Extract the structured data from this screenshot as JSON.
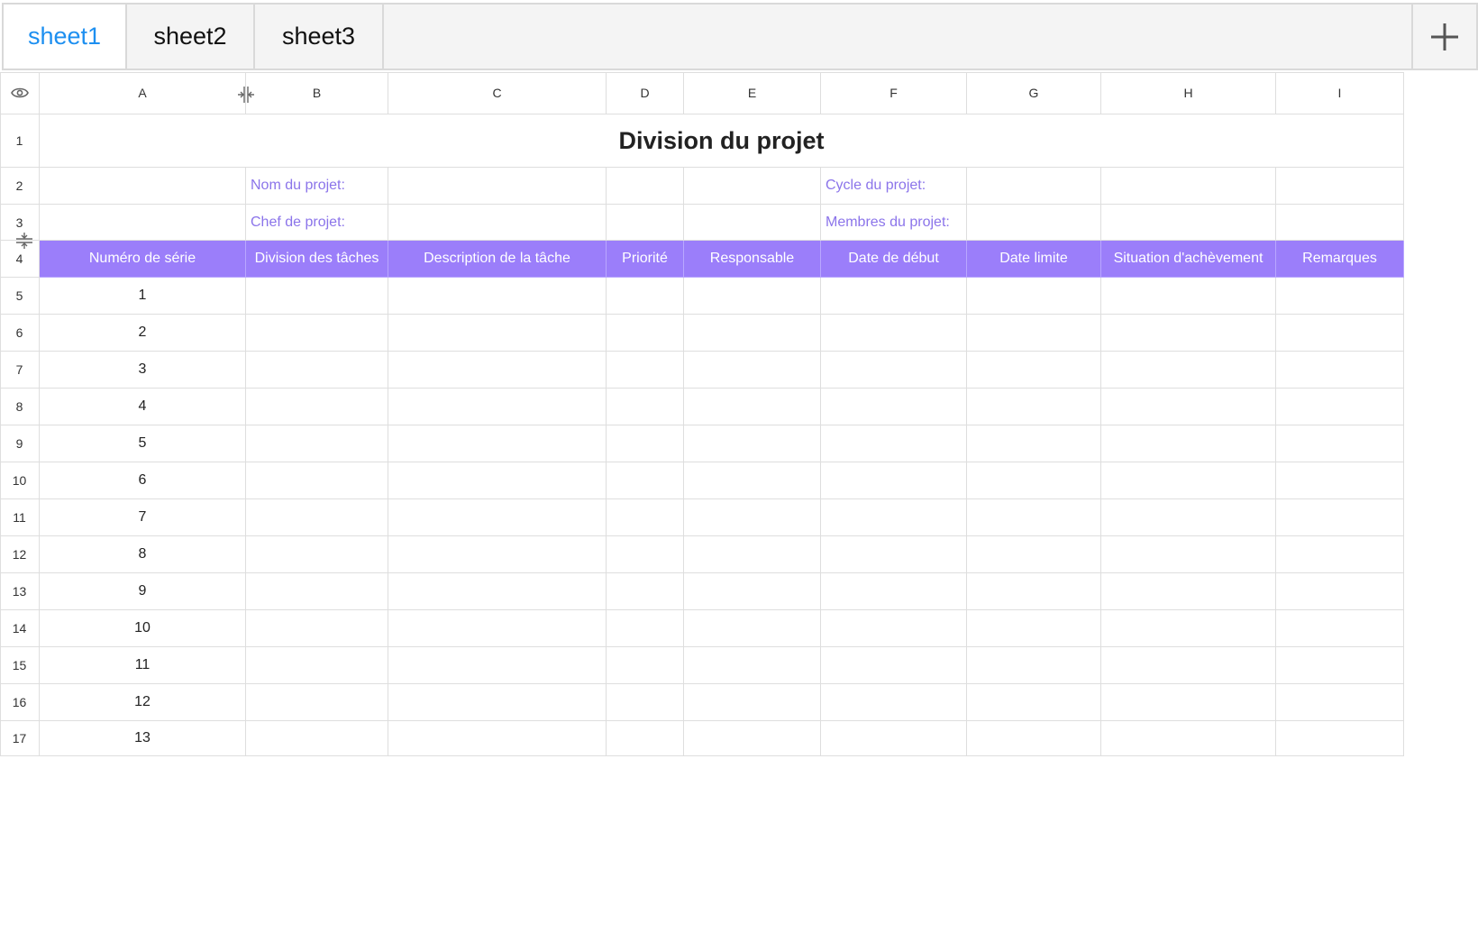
{
  "tabs": [
    {
      "label": "sheet1",
      "active": true
    },
    {
      "label": "sheet2",
      "active": false
    },
    {
      "label": "sheet3",
      "active": false
    }
  ],
  "icons": {
    "add_tab": "plus-icon",
    "corner": "eye-icon",
    "col_resize": "column-resize-icon",
    "row_resize": "row-resize-icon"
  },
  "colors": {
    "accent_tab": "#1d8ff0",
    "header_fill": "#9b7efa",
    "label_text": "#8b74ea"
  },
  "columns": [
    "A",
    "B",
    "C",
    "D",
    "E",
    "F",
    "G",
    "H",
    "I"
  ],
  "rows": [
    "1",
    "2",
    "3",
    "4",
    "5",
    "6",
    "7",
    "8",
    "9",
    "10",
    "11",
    "12",
    "13",
    "14",
    "15",
    "16",
    "17"
  ],
  "sheet": {
    "title": "Division du projet",
    "labels": {
      "project_name": "Nom du projet:",
      "project_cycle": "Cycle du projet:",
      "project_lead": "Chef de projet:",
      "project_members": "Membres du projet:"
    },
    "headers": [
      "Numéro de série",
      "Division des tâches",
      "Description de la tâche",
      "Priorité",
      "Responsable",
      "Date de début",
      "Date limite",
      "Situation d'achèvement",
      "Remarques"
    ],
    "serial_numbers": [
      "1",
      "2",
      "3",
      "4",
      "5",
      "6",
      "7",
      "8",
      "9",
      "10",
      "11",
      "12",
      "13"
    ]
  }
}
